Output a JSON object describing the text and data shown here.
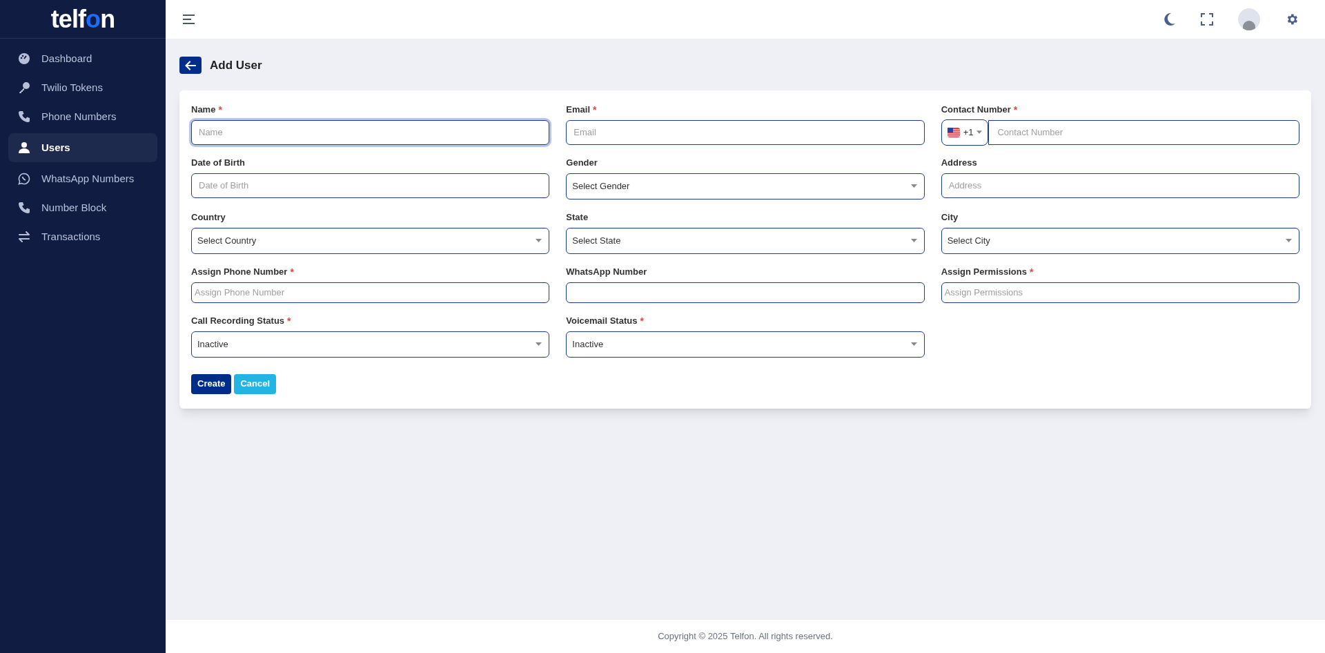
{
  "sidebar": {
    "logo": {
      "text_before": "telf",
      "text_highlight": "o",
      "text_after": "n"
    },
    "items": [
      {
        "label": "Dashboard",
        "selected": false
      },
      {
        "label": "Twilio Tokens",
        "selected": false
      },
      {
        "label": "Phone Numbers",
        "selected": false
      },
      {
        "label": "Users",
        "selected": true
      },
      {
        "label": "WhatsApp Numbers",
        "selected": false
      },
      {
        "label": "Number Block",
        "selected": false
      },
      {
        "label": "Transactions",
        "selected": false
      }
    ]
  },
  "page": {
    "title": "Add User"
  },
  "form": {
    "fields": [
      {
        "label": "Name",
        "required_mark": "*",
        "kind": "text",
        "placeholder": "Name",
        "focused": true
      },
      {
        "label": "Email",
        "required_mark": "*",
        "kind": "text",
        "placeholder": "Email",
        "focused": false
      },
      {
        "label": "Contact Number",
        "required_mark": "*",
        "kind": "phone",
        "dial_code": "+1",
        "placeholder": "Contact Number",
        "focused": false
      },
      {
        "label": "Date of Birth",
        "kind": "text",
        "placeholder": "Date of Birth",
        "focused": false
      },
      {
        "label": "Gender",
        "kind": "select",
        "value": "Select Gender",
        "focused": false
      },
      {
        "label": "Address",
        "kind": "text",
        "placeholder": "Address",
        "focused": false
      },
      {
        "label": "Country",
        "kind": "select",
        "value": "Select Country",
        "focused": false
      },
      {
        "label": "State",
        "kind": "select",
        "value": "Select State",
        "focused": false
      },
      {
        "label": "City",
        "kind": "select",
        "value": "Select City",
        "focused": false
      },
      {
        "label": "Assign Phone Number",
        "required_mark": "*",
        "kind": "multi",
        "placeholder": "Assign Phone Number",
        "focused": false
      },
      {
        "label": "WhatsApp Number",
        "kind": "multi",
        "focused": false
      },
      {
        "label": "Assign Permissions",
        "required_mark": "*",
        "kind": "multi",
        "placeholder": "Assign Permissions",
        "focused": false
      },
      {
        "label": "Call Recording Status",
        "required_mark": "*",
        "kind": "select",
        "value": "Inactive",
        "focused": false
      },
      {
        "label": "Voicemail Status",
        "required_mark": "*",
        "kind": "select",
        "value": "Inactive",
        "focused": false
      }
    ],
    "buttons": [
      {
        "label": "Create",
        "kind": "primary"
      },
      {
        "label": "Cancel",
        "kind": "secondary"
      }
    ]
  },
  "footer": {
    "text": "Copyright © 2025 Telfon. All rights reserved."
  }
}
